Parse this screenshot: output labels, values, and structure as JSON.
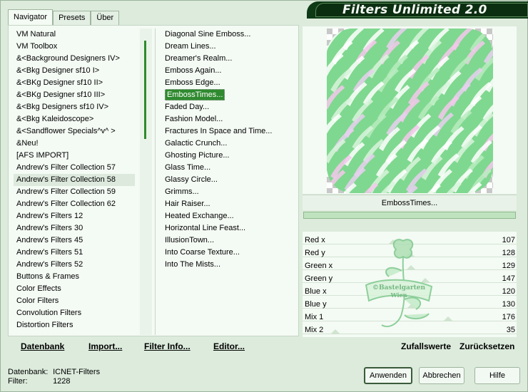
{
  "header": {
    "title": "Filters Unlimited 2.0"
  },
  "tabs": [
    {
      "label": "Navigator",
      "active": true
    },
    {
      "label": "Presets",
      "active": false
    },
    {
      "label": "Über",
      "active": false
    }
  ],
  "categories": [
    "VM Natural",
    "VM Toolbox",
    "&<Background Designers IV>",
    "&<Bkg Designer sf10 I>",
    "&<BKg Designer sf10 II>",
    "&<BKg Designer sf10 III>",
    "&<Bkg Designers sf10 IV>",
    "&<Bkg Kaleidoscope>",
    "&<Sandflower Specials^v^ >",
    "&Neu!",
    "[AFS IMPORT]",
    "Andrew's Filter Collection 57",
    "Andrew's Filter Collection 58",
    "Andrew's Filter Collection 59",
    "Andrew's Filter Collection 62",
    "Andrew's Filters 12",
    "Andrew's Filters 30",
    "Andrew's Filters 45",
    "Andrew's Filters 51",
    "Andrew's Filters 52",
    "Buttons & Frames",
    "Color Effects",
    "Color Filters",
    "Convolution Filters",
    "Distortion Filters"
  ],
  "selected_category_index": 12,
  "filters": [
    "Diagonal Sine Emboss...",
    "Dream Lines...",
    "Dreamer's Realm...",
    "Emboss Again...",
    "Emboss Edge...",
    "EmbossTimes...",
    "Faded Day...",
    "Fashion Model...",
    "Fractures In Space and Time...",
    "Galactic Crunch...",
    "Ghosting Picture...",
    "Glass Time...",
    "Glassy Circle...",
    "Grimms...",
    "Hair Raiser...",
    "Heated Exchange...",
    "Horizontal Line Feast...",
    "IllusionTown...",
    "Into Coarse Texture...",
    "Into The Mists..."
  ],
  "selected_filter_index": 5,
  "left_buttons": {
    "database": "Datenbank",
    "import": "Import...",
    "filter_info": "Filter Info...",
    "editor": "Editor..."
  },
  "preview": {
    "filter_name": "EmbossTimes...",
    "progress": 1.0
  },
  "params": [
    {
      "label": "Red x",
      "value": 107
    },
    {
      "label": "Red y",
      "value": 128
    },
    {
      "label": "Green x",
      "value": 129
    },
    {
      "label": "Green y",
      "value": 147
    },
    {
      "label": "Blue x",
      "value": 120
    },
    {
      "label": "Blue y",
      "value": 130
    },
    {
      "label": "Mix 1",
      "value": 176
    },
    {
      "label": "Mix 2",
      "value": 35
    }
  ],
  "watermark": {
    "line1": "©Bastelgarten",
    "line2": "Wien"
  },
  "right_buttons": {
    "random": "Zufallswerte",
    "reset": "Zurücksetzen"
  },
  "status": {
    "database_label": "Datenbank:",
    "database_value": "ICNET-Filters",
    "filter_label": "Filter:",
    "filter_value": "1228"
  },
  "dialog_buttons": {
    "apply": "Anwenden",
    "cancel": "Abbrechen",
    "help": "Hilfe"
  },
  "colors": {
    "accent": "#2f8a2f",
    "banner": "#0e3a16",
    "background": "#dcebdc"
  }
}
